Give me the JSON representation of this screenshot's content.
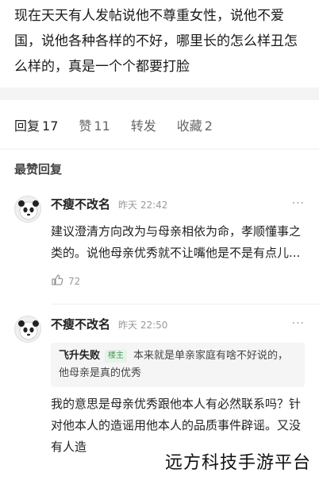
{
  "post": {
    "text": "现在天天有人发帖说他不尊重女性，说他不爱国，说他各种各样的不好，哪里长的怎么样丑怎么样的，真是一个个都要打脸"
  },
  "tabs": [
    {
      "label": "回复",
      "count": "17",
      "active": true
    },
    {
      "label": "赞",
      "count": "11"
    },
    {
      "label": "转发",
      "count": ""
    },
    {
      "label": "收藏",
      "count": "2"
    }
  ],
  "section_title": "最赞回复",
  "comments": [
    {
      "author": "不瘦不改名",
      "time": "昨天 22:42",
      "text": "建议澄清方向改为与母亲相依为命，孝顺懂事之类的。说他母亲优秀就不让嘴他是不是有点儿...",
      "likes": "72",
      "avatar_icon": "panda-avatar"
    },
    {
      "author": "不瘦不改名",
      "time": "昨天 22:50",
      "quote": {
        "author": "飞升失败",
        "badge": "楼主",
        "text": "本来就是单亲家庭有啥不好说的，他母亲是真的优秀"
      },
      "text": "我的意思是母亲优秀跟他本人有必然联系吗？针对他本人的造谣用他本人的品质事件辟谣。又没有人造",
      "avatar_icon": "panda-avatar"
    }
  ],
  "more_label": "···",
  "watermark": "远方科技手游平台",
  "colors": {
    "badge_green": "#4a9a57",
    "muted": "#999999",
    "gap": "#f4f4f4"
  }
}
